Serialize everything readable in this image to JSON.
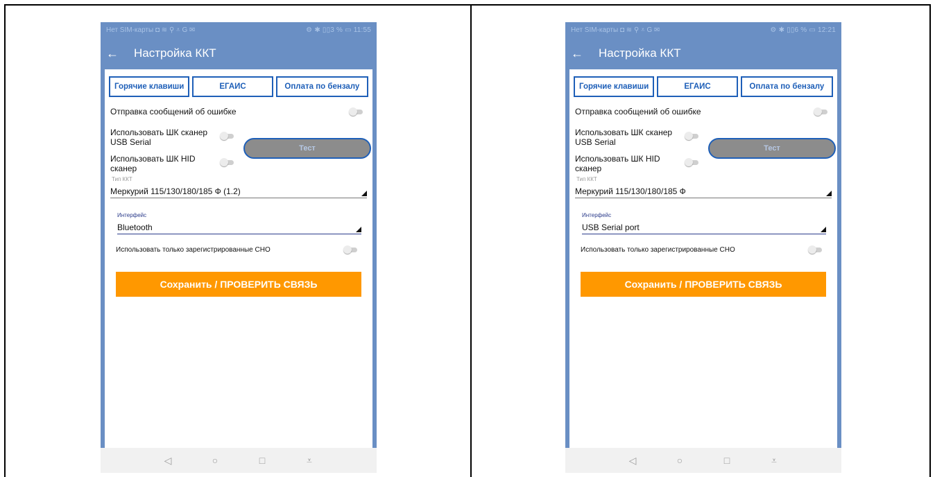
{
  "screens": [
    {
      "status": {
        "left": "Нет SIM-карты ◘ ≋ ⚲ ⩡ G ✉",
        "right": "⚙ ✱ ▯▯3 % ▭ 11:55"
      },
      "appbar": {
        "back": "←",
        "title": "Настройка ККТ"
      },
      "tabs": [
        "Горячие клавиши",
        "ЕГАИС",
        "Оплата по бензалу"
      ],
      "send_errors_label": "Отправка сообщений об ошибке",
      "usb_scanner_label": "Использовать ШК сканер USB Serial",
      "hid_scanner_label": "Использовать ШК HID сканер",
      "test_button": "Тест",
      "kkt_type_label": "Тип ККТ",
      "kkt_type_value": "Меркурий 115/130/180/185 Ф (1.2)",
      "interface_label": "Интерфейс",
      "interface_value": "Bluetooth",
      "registered_sno_label": "Использовать только зарегистрированные СНО",
      "save_button": "Сохранить / ПРОВЕРИТЬ СВЯЗЬ"
    },
    {
      "status": {
        "left": "Нет SIM-карты ◘ ≋ ⚲ ⩡ G ✉",
        "right": "⚙ ✱ ▯▯6 % ▭ 12:21"
      },
      "appbar": {
        "back": "←",
        "title": "Настройка ККТ"
      },
      "tabs": [
        "Горячие клавиши",
        "ЕГАИС",
        "Оплата по бензалу"
      ],
      "send_errors_label": "Отправка сообщений об ошибке",
      "usb_scanner_label": "Использовать ШК сканер USB Serial",
      "hid_scanner_label": "Использовать ШК HID сканер",
      "test_button": "Тест",
      "kkt_type_label": "Тип ККТ",
      "kkt_type_value": "Меркурий 115/130/180/185 Ф",
      "interface_label": "Интерфейс",
      "interface_value": "USB Serial port",
      "registered_sno_label": "Использовать только зарегистрированные СНО",
      "save_button": "Сохранить / ПРОВЕРИТЬ СВЯЗЬ"
    }
  ],
  "icons": {
    "back": "arrow-left-icon",
    "nav_back": "triangle-back-icon",
    "nav_home": "circle-home-icon",
    "nav_recent": "square-recent-icon",
    "nav_menu": "download-menu-icon"
  },
  "colors": {
    "appbar": "#6a8fc4",
    "tab_border": "#1e5fb8",
    "save_button": "#ff9800",
    "test_button": "#8c8c8c"
  },
  "navbar": {
    "back": "◁",
    "home": "○",
    "recent": "□",
    "menu": "⩡"
  }
}
